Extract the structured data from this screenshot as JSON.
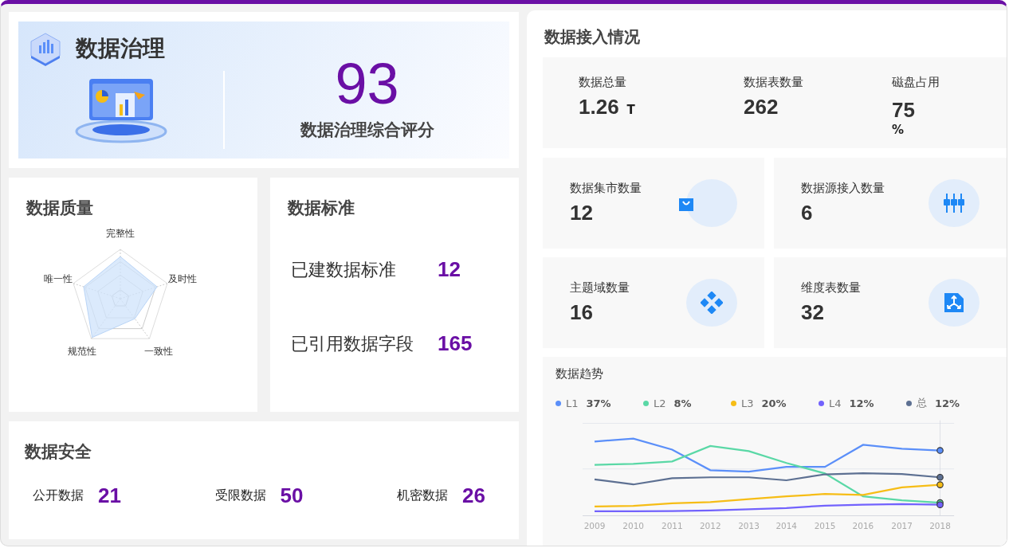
{
  "governance": {
    "title": "数据治理",
    "score": "93",
    "score_label": "数据治理综合评分"
  },
  "quality": {
    "title": "数据质量",
    "axes": [
      "完整性",
      "及时性",
      "一致性",
      "规范性",
      "唯一性"
    ]
  },
  "standard": {
    "title": "数据标准",
    "items": [
      {
        "label": "已建数据标准",
        "value": "12"
      },
      {
        "label": "已引用数据字段",
        "value": "165"
      }
    ]
  },
  "security": {
    "title": "数据安全",
    "items": [
      {
        "label": "公开数据",
        "value": "21"
      },
      {
        "label": "受限数据",
        "value": "50"
      },
      {
        "label": "机密数据",
        "value": "26"
      }
    ]
  },
  "access": {
    "title": "数据接入情况",
    "stats": [
      {
        "label": "数据总量",
        "value": "1.26",
        "unit": "T",
        "kind": "inline"
      },
      {
        "label": "数据表数量",
        "value": "262",
        "kind": "plain"
      },
      {
        "label": "磁盘占用",
        "value": "75",
        "unit": "%",
        "kind": "below"
      }
    ],
    "cards": [
      {
        "label": "数据集市数量",
        "value": "12",
        "kind": "bag"
      },
      {
        "label": "数据源接入数量",
        "value": "6",
        "kind": "plugs"
      },
      {
        "label": "主题域数量",
        "value": "16",
        "kind": "diamonds"
      },
      {
        "label": "维度表数量",
        "value": "32",
        "kind": "share"
      }
    ]
  },
  "trend": {
    "title": "数据趋势",
    "legend": [
      {
        "name": "L1",
        "value": "37%",
        "color": "#5b8ff9"
      },
      {
        "name": "L2",
        "value": "8%",
        "color": "#5ad8a6"
      },
      {
        "name": "L3",
        "value": "20%",
        "color": "#f6bd16"
      },
      {
        "name": "L4",
        "value": "12%",
        "color": "#7262fd"
      },
      {
        "name": "总",
        "value": "12%",
        "color": "#5d7092"
      }
    ],
    "years": [
      "2009",
      "2010",
      "2011",
      "2012",
      "2013",
      "2014",
      "2015",
      "2016",
      "2017",
      "2018"
    ]
  }
}
